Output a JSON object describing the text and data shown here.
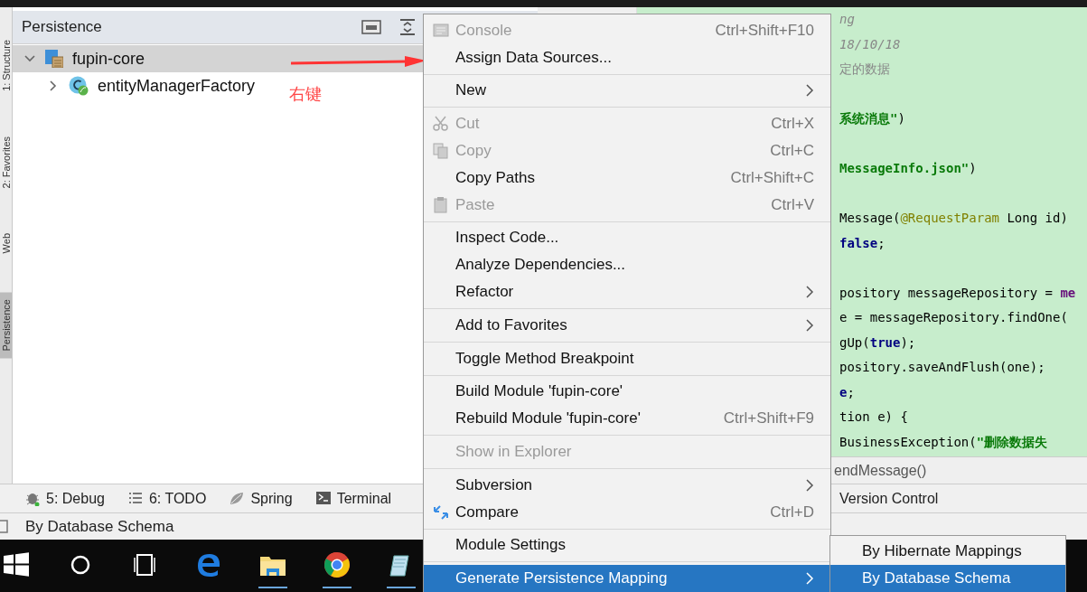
{
  "side_tabs": [
    {
      "label": "1: Structure",
      "selected": false
    },
    {
      "label": "2: Favorites",
      "selected": false
    },
    {
      "label": "Web",
      "selected": false
    },
    {
      "label": "Persistence",
      "selected": true
    }
  ],
  "panel": {
    "title": "Persistence",
    "tree": [
      {
        "label": "fupin-core",
        "selected": true,
        "expanded": true,
        "kind": "module",
        "children": [
          {
            "label": "entityManagerFactory",
            "selected": false,
            "expanded": false,
            "kind": "bean"
          }
        ]
      }
    ]
  },
  "annotation": {
    "label": "右键"
  },
  "editor": {
    "lines": [
      {
        "segments": [
          {
            "kind": "comment",
            "text": "ng"
          }
        ]
      },
      {
        "segments": [
          {
            "kind": "comment",
            "text": "18/10/18"
          }
        ]
      },
      {
        "segments": [
          {
            "kind": "doc",
            "text": "定的数据"
          }
        ]
      },
      {
        "blank_before": true,
        "segments": [
          {
            "kind": "string",
            "text": "系统消息\""
          },
          {
            "kind": "plain",
            "text": ")"
          }
        ]
      },
      {
        "blank_before": true,
        "segments": [
          {
            "kind": "string",
            "text": "MessageInfo.json\""
          },
          {
            "kind": "plain",
            "text": ")"
          }
        ]
      },
      {
        "blank_before": true,
        "segments": [
          {
            "kind": "plain",
            "text": "Message("
          },
          {
            "kind": "annotation",
            "text": "@RequestParam"
          },
          {
            "kind": "plain",
            "text": " Long id)"
          }
        ]
      },
      {
        "segments": [
          {
            "kind": "keyword",
            "text": "false"
          },
          {
            "kind": "plain",
            "text": ";"
          }
        ]
      },
      {
        "blank_before": true,
        "segments": [
          {
            "kind": "plain",
            "text": "pository messageRepository = "
          },
          {
            "kind": "field",
            "text": "me"
          }
        ]
      },
      {
        "segments": [
          {
            "kind": "plain",
            "text": "e = messageRepository.findOne("
          }
        ]
      },
      {
        "segments": [
          {
            "kind": "plain",
            "text": "gUp("
          },
          {
            "kind": "keyword",
            "text": "true"
          },
          {
            "kind": "plain",
            "text": ");"
          }
        ]
      },
      {
        "segments": [
          {
            "kind": "plain",
            "text": "pository.saveAndFlush(one);"
          }
        ]
      },
      {
        "segments": [
          {
            "kind": "keyword",
            "text": "e"
          },
          {
            "kind": "plain",
            "text": ";"
          }
        ]
      },
      {
        "segments": [
          {
            "kind": "plain",
            "text": "tion e) {"
          }
        ]
      },
      {
        "segments": [
          {
            "kind": "plain",
            "text": "BusinessException("
          },
          {
            "kind": "string",
            "text": "\"删除数据失"
          }
        ]
      }
    ],
    "breadcrumb": "endMessage()"
  },
  "tool_tabs": [
    {
      "label": "5: Debug",
      "kind": "debug"
    },
    {
      "label": "6: TODO",
      "kind": "todo"
    },
    {
      "label": "Spring",
      "kind": "spring"
    },
    {
      "label": "Terminal",
      "kind": "terminal"
    }
  ],
  "right_tool_tab": {
    "label": "Version Control"
  },
  "status_bar": {
    "text": "By Database Schema"
  },
  "context_menu": {
    "groups": [
      [
        {
          "label": "Console",
          "shortcut": "Ctrl+Shift+F10",
          "disabled": true,
          "kind": "console"
        },
        {
          "label": "Assign Data Sources...",
          "disabled": false
        }
      ],
      [
        {
          "label": "New",
          "submenu": true,
          "disabled": false
        }
      ],
      [
        {
          "label": "Cut",
          "shortcut": "Ctrl+X",
          "disabled": true,
          "kind": "cut"
        },
        {
          "label": "Copy",
          "shortcut": "Ctrl+C",
          "disabled": true,
          "kind": "copy"
        },
        {
          "label": "Copy Paths",
          "shortcut": "Ctrl+Shift+C",
          "disabled": false
        },
        {
          "label": "Paste",
          "shortcut": "Ctrl+V",
          "disabled": true,
          "kind": "paste"
        }
      ],
      [
        {
          "label": "Inspect Code...",
          "disabled": false
        },
        {
          "label": "Analyze Dependencies...",
          "disabled": false
        },
        {
          "label": "Refactor",
          "submenu": true,
          "disabled": false
        }
      ],
      [
        {
          "label": "Add to Favorites",
          "submenu": true,
          "disabled": false
        }
      ],
      [
        {
          "label": "Toggle Method Breakpoint",
          "disabled": false
        }
      ],
      [
        {
          "label": "Build Module 'fupin-core'",
          "disabled": false
        },
        {
          "label": "Rebuild Module 'fupin-core'",
          "shortcut": "Ctrl+Shift+F9",
          "disabled": false
        }
      ],
      [
        {
          "label": "Show in Explorer",
          "disabled": true
        }
      ],
      [
        {
          "label": "Subversion",
          "submenu": true,
          "disabled": false
        },
        {
          "label": "Compare",
          "shortcut": "Ctrl+D",
          "disabled": false,
          "kind": "compare"
        }
      ],
      [
        {
          "label": "Module Settings",
          "disabled": false
        }
      ],
      [
        {
          "label": "Generate Persistence Mapping",
          "submenu": true,
          "disabled": false,
          "selected": true
        }
      ]
    ]
  },
  "submenu": {
    "items": [
      {
        "label": "By Hibernate Mappings",
        "selected": false
      },
      {
        "label": "By Database Schema",
        "selected": true
      }
    ]
  }
}
